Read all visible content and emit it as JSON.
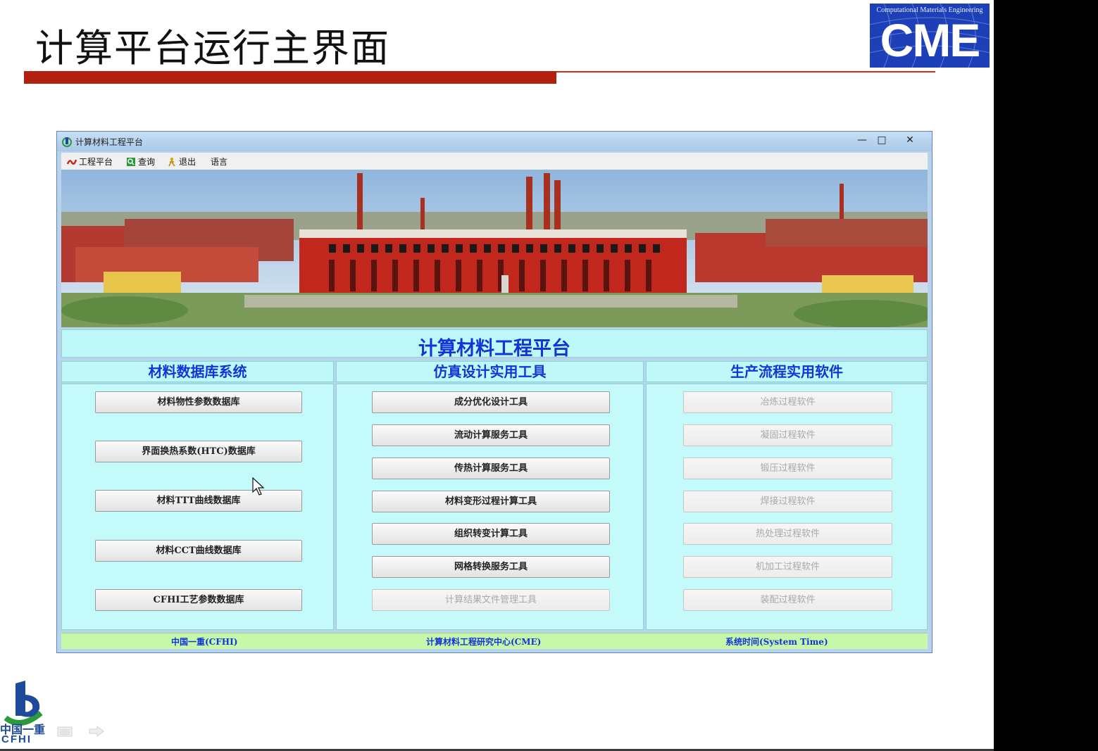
{
  "slide": {
    "title": "计算平台运行主界面",
    "logo": {
      "subtitle": "Computational Materials Engineering",
      "text": "CME"
    },
    "footer_logo": {
      "line1": "中国一重",
      "line2": "CFHI"
    }
  },
  "window": {
    "title": "计算材料工程平台",
    "controls": {
      "minimize": "—",
      "maximize": "□",
      "close": "✕"
    },
    "menu": [
      {
        "label": "工程平台",
        "icon": "platform-icon"
      },
      {
        "label": "查询",
        "icon": "search-icon"
      },
      {
        "label": "退出",
        "icon": "exit-icon"
      },
      {
        "label": "语言",
        "icon": ""
      }
    ],
    "platform_title": "计算材料工程平台",
    "columns": [
      {
        "heading": "材料数据库系统",
        "buttons": [
          {
            "label": "材料物性参数数据库",
            "enabled": true
          },
          {
            "label": "界面换热系数(HTC)数据库",
            "enabled": true
          },
          {
            "label": "材料TTT曲线数据库",
            "enabled": true
          },
          {
            "label": "材料CCT曲线数据库",
            "enabled": true
          },
          {
            "label": "CFHI工艺参数数据库",
            "enabled": true
          }
        ]
      },
      {
        "heading": "仿真设计实用工具",
        "buttons": [
          {
            "label": "成分优化设计工具",
            "enabled": true
          },
          {
            "label": "流动计算服务工具",
            "enabled": true
          },
          {
            "label": "传热计算服务工具",
            "enabled": true
          },
          {
            "label": "材料变形过程计算工具",
            "enabled": true
          },
          {
            "label": "组织转变计算工具",
            "enabled": true
          },
          {
            "label": "网格转换服务工具",
            "enabled": true
          },
          {
            "label": "计算结果文件管理工具",
            "enabled": false
          }
        ]
      },
      {
        "heading": "生产流程实用软件",
        "buttons": [
          {
            "label": "冶炼过程软件",
            "enabled": false
          },
          {
            "label": "凝固过程软件",
            "enabled": false
          },
          {
            "label": "锻压过程软件",
            "enabled": false
          },
          {
            "label": "焊接过程软件",
            "enabled": false
          },
          {
            "label": "热处理过程软件",
            "enabled": false
          },
          {
            "label": "机加工过程软件",
            "enabled": false
          },
          {
            "label": "装配过程软件",
            "enabled": false
          }
        ]
      }
    ],
    "status": [
      "中国一重(CFHI)",
      "计算材料工程研究中心(CME)",
      "系统时间(System Time)"
    ]
  },
  "colors": {
    "accent_red": "#b3200f",
    "heading_blue": "#1235d8",
    "panel_cyan": "#c4fafa",
    "status_green": "#c7f7a9"
  }
}
